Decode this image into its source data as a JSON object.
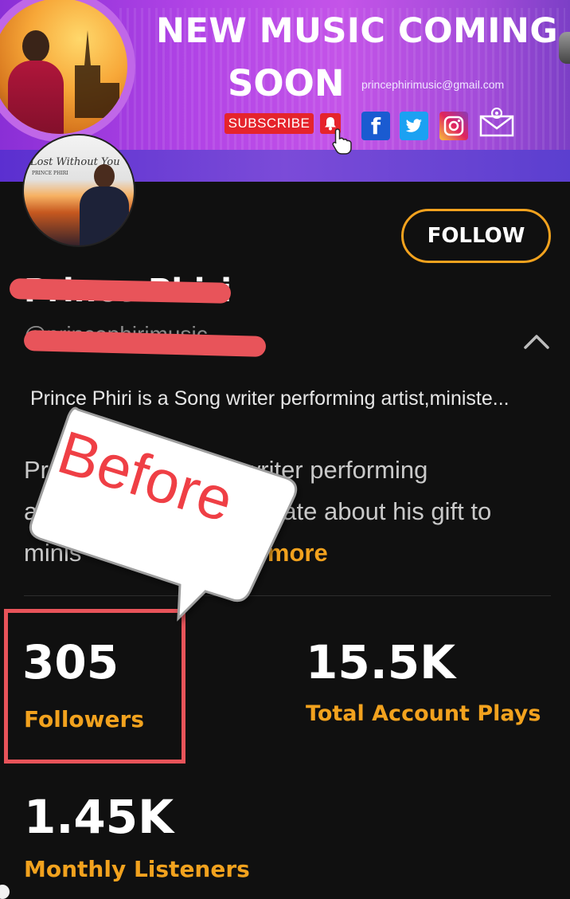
{
  "banner": {
    "title": "NEW MUSIC COMING",
    "title_line2": "SOON",
    "email": "princephirimusic@gmail.com",
    "subscribe_label": "SUBSCRIBE",
    "social_icons": [
      "facebook-icon",
      "twitter-icon",
      "instagram-icon",
      "mail-icon"
    ],
    "colors": {
      "banner": "#b244e6",
      "subscribe": "#e5242c"
    }
  },
  "avatar": {
    "album_title": "Lost Without You",
    "album_artist": "PRINCE PHIRI"
  },
  "profile": {
    "follow_label": "FOLLOW",
    "name": "Prince Phiri",
    "handle": "@princephirimusic",
    "bio_short": "Prince Phiri is a Song writer performing artist,ministe...",
    "bio_full": "Prince Phiri is a Song writer performing artist, passionate about his gift to minister",
    "bio_visible_line1": "Pr",
    "bio_visible_line1b": "g writer performing",
    "bio_visible_line2": "a",
    "bio_visible_line2b": "ate about his gift to",
    "bio_visible_line3": "minis",
    "read_more_label": "d more",
    "accent_color": "#f2a21e"
  },
  "stats": {
    "followers": {
      "value": "305",
      "label": "Followers"
    },
    "plays": {
      "value": "15.5K",
      "label": "Total Account Plays"
    },
    "listeners": {
      "value": "1.45K",
      "label": "Monthly Listeners"
    }
  },
  "annotation": {
    "callout_text": "Before",
    "highlight_color": "#e8545a"
  }
}
